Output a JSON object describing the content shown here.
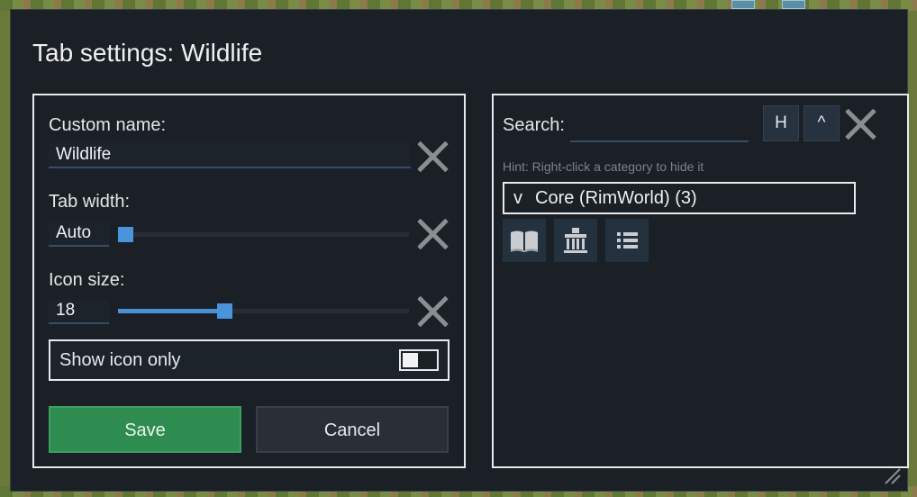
{
  "dialog": {
    "title": "Tab settings: Wildlife"
  },
  "left_panel": {
    "custom_name_label": "Custom name:",
    "custom_name_value": "Wildlife",
    "tab_width_label": "Tab width:",
    "tab_width_value": "Auto",
    "tab_width_slider_fraction": 0.0,
    "icon_size_label": "Icon size:",
    "icon_size_value": "18",
    "icon_size_slider_fraction": 0.36,
    "show_icon_only_label": "Show icon only",
    "show_icon_only_enabled": false,
    "save_label": "Save",
    "cancel_label": "Cancel"
  },
  "right_panel": {
    "search_label": "Search:",
    "search_value": "",
    "h_button_label": "H",
    "up_button_label": "^",
    "hint": "Hint: Right-click a category to hide it",
    "category": {
      "caret": "v",
      "name": "Core (RimWorld) (3)"
    },
    "icons": [
      "book-icon",
      "building-icon",
      "list-icon"
    ]
  },
  "colors": {
    "dialog_bg": "#1b2026",
    "accent_blue": "#4a94dc",
    "save_green": "#2f8c50",
    "cancel_gray": "#2a2f37"
  }
}
